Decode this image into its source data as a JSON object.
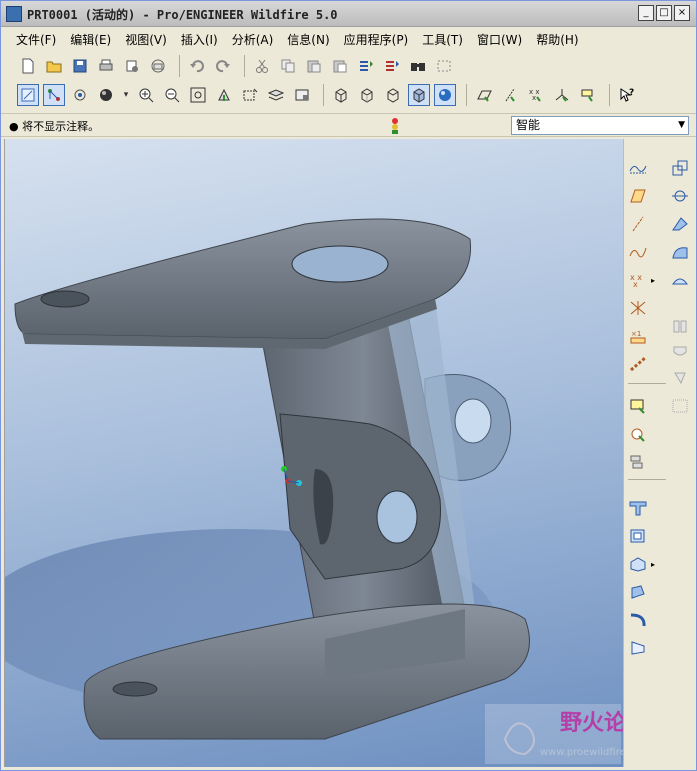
{
  "window": {
    "title": "PRT0001 (活动的) - Pro/ENGINEER Wildfire 5.0",
    "min_label": "_",
    "max_label": "□",
    "close_label": "×"
  },
  "menu": [
    {
      "label": "文件(F)"
    },
    {
      "label": "编辑(E)"
    },
    {
      "label": "视图(V)"
    },
    {
      "label": "插入(I)"
    },
    {
      "label": "分析(A)"
    },
    {
      "label": "信息(N)"
    },
    {
      "label": "应用程序(P)"
    },
    {
      "label": "工具(T)"
    },
    {
      "label": "窗口(W)"
    },
    {
      "label": "帮助(H)"
    }
  ],
  "status": {
    "message": "● 将不显示注释。",
    "filter_value": "智能"
  },
  "watermark": {
    "brand": "野火论坛",
    "url": "www.proewildfire.cn"
  },
  "colors": {
    "viewport_top": "#d6e1ef",
    "viewport_bottom": "#6d8fc0",
    "part": "#6b7480",
    "accent": "#3b6db5"
  },
  "icons": {
    "toolbar1": [
      "new-icon",
      "open-icon",
      "save-icon",
      "print-icon",
      "send-icon",
      "mail-icon",
      "undo-icon",
      "redo-icon",
      "cut-icon",
      "copy-icon",
      "paste-icon",
      "paste-special-icon",
      "regenerate-icon",
      "regen-manager-icon",
      "find-icon",
      "select-box-icon"
    ],
    "toolbar2": [
      "redraw-icon",
      "spin-center-icon",
      "orient-mode-icon",
      "appearance-icon",
      "zoom-in-icon",
      "zoom-out-icon",
      "refit-icon",
      "reorient-icon",
      "saved-views-icon",
      "layers-icon",
      "view-manager-icon",
      "wireframe-icon",
      "hidden-line-icon",
      "no-hidden-icon",
      "shading-icon",
      "enhanced-realism-icon",
      "datum-planes-icon",
      "datum-axes-icon",
      "datum-points-icon",
      "coord-sys-icon",
      "annotations-icon",
      "context-help-icon"
    ],
    "rightbar": [
      "sketch-icon",
      "datum-plane-icon",
      "datum-axis-icon",
      "datum-curve-icon",
      "datum-point-icon",
      "coord-system-icon",
      "analysis-icon",
      "copy-icon",
      "sketch-tool-icon",
      "sketched-datum-icon",
      "analysis-feature-icon",
      "extrude-icon",
      "revolve-icon",
      "variable-sweep-icon",
      "blend-icon",
      "boundary-blend-icon",
      "hole-icon",
      "shell-icon",
      "rib-icon",
      "draft-icon",
      "round-icon",
      "chamfer-icon",
      "mirror-icon",
      "merge-icon",
      "trim-icon",
      "pattern-icon",
      "thicken-icon",
      "solidify-icon"
    ]
  }
}
